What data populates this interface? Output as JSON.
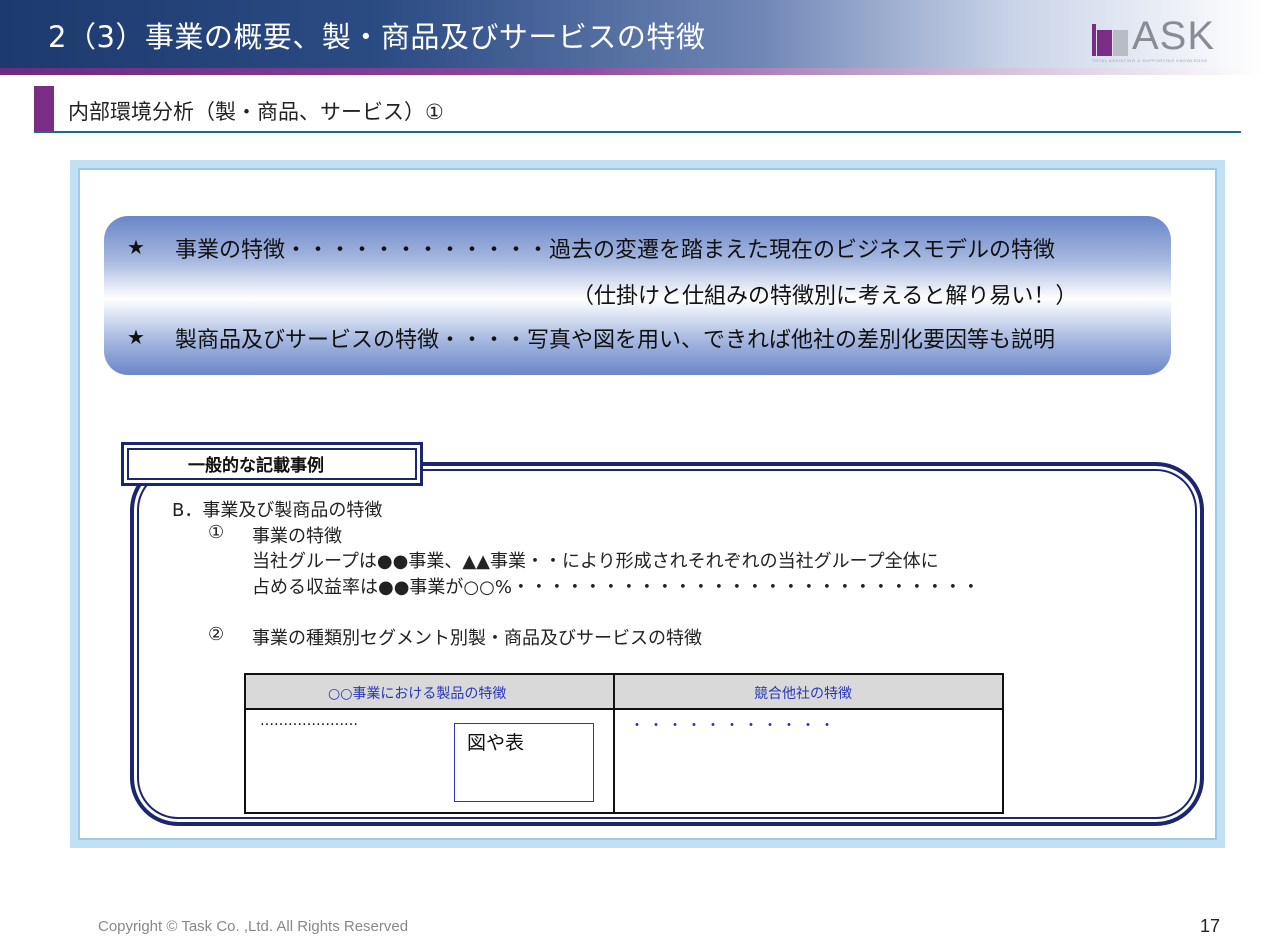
{
  "header": {
    "title": "2（3）事業の概要、製・商品及びサービスの特徴",
    "logo_text": "ASK",
    "logo_tagline": "TOTAL ASSISTING & SUPPORTING KNOWLEDGE"
  },
  "subtitle": "内部環境分析（製・商品、サービス）①",
  "summary": {
    "star": "★",
    "line1": "事業の特徴・・・・・・・・・・・・過去の変遷を踏まえた現在のビジネスモデルの特徴",
    "line2": "（仕掛けと仕組みの特徴別に考えると解り易い！）",
    "line3": "製商品及びサービスの特徴・・・・写真や図を用い、できれば他社の差別化要因等も説明"
  },
  "example": {
    "label": "一般的な記載事例",
    "heading": "B．事業及び製商品の特徴",
    "item1_num": "①",
    "item1_title": "事業の特徴",
    "item1_text1": "当社グループは●●事業、▲▲事業・・により形成されそれぞれの当社グループ全体に",
    "item1_text2": "占める収益率は●●事業が○○%・・・・・・・・・・・・・・・・・・・・・・・・・・",
    "item2_num": "②",
    "item2_title": "事業の種類別セグメント別製・商品及びサービスの特徴"
  },
  "table": {
    "headers": [
      "○○事業における製品の特徴",
      "競合他社の特徴"
    ],
    "cell1_dots": "…………………",
    "figure_label": "図や表",
    "cell2_dots": "・・・・・・・・・・・"
  },
  "footer": {
    "copyright": "Copyright © Task Co. ,Ltd. All Rights Reserved",
    "page": "17"
  },
  "colors": {
    "banner_dark": "#1d3a6e",
    "accent_purple": "#7b2d86",
    "frame_blue": "#c2e0f4",
    "box_navy": "#1b2570",
    "table_text_blue": "#2a36b8"
  }
}
